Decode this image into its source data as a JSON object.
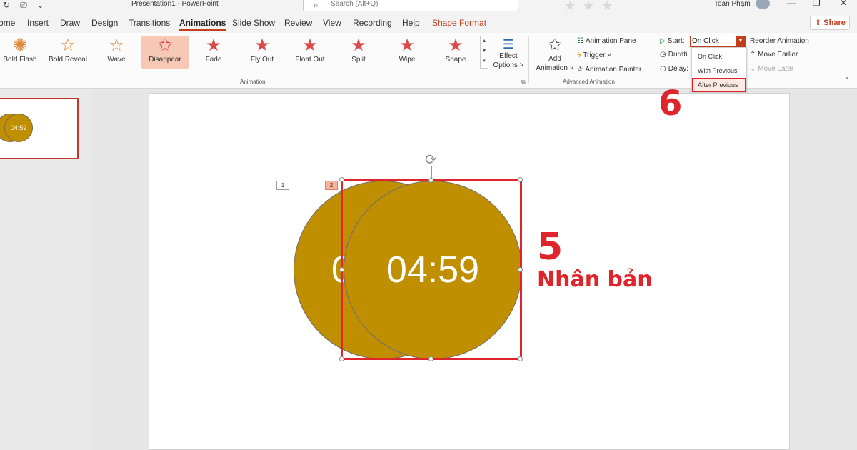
{
  "window": {
    "doc_title": "Presentation1 - PowerPoint",
    "search_placeholder": "Search (Alt+Q)",
    "user_name": "Toàn Phạm"
  },
  "tabs": [
    {
      "label": "ome"
    },
    {
      "label": "Insert"
    },
    {
      "label": "Draw"
    },
    {
      "label": "Design"
    },
    {
      "label": "Transitions"
    },
    {
      "label": "Animations",
      "active": true
    },
    {
      "label": "Slide Show"
    },
    {
      "label": "Review"
    },
    {
      "label": "View"
    },
    {
      "label": "Recording"
    },
    {
      "label": "Help"
    },
    {
      "label": "Shape Format",
      "contextual": true
    }
  ],
  "share_label": "Share",
  "ribbon": {
    "animations": [
      {
        "label": "Bold Flash",
        "icon": "star-burst-icon",
        "color": "#e08a3a"
      },
      {
        "label": "Bold Reveal",
        "icon": "star-b-icon",
        "color": "#e08a3a"
      },
      {
        "label": "Wave",
        "icon": "star-a-icon",
        "color": "#e08a3a"
      },
      {
        "label": "Disappear",
        "icon": "star-outline-icon",
        "color": "#d94a4a",
        "selected": true
      },
      {
        "label": "Fade",
        "icon": "star-icon",
        "color": "#d94a4a"
      },
      {
        "label": "Fly Out",
        "icon": "star-icon",
        "color": "#d94a4a"
      },
      {
        "label": "Float Out",
        "icon": "star-icon",
        "color": "#d94a4a"
      },
      {
        "label": "Split",
        "icon": "star-icon",
        "color": "#d94a4a"
      },
      {
        "label": "Wipe",
        "icon": "star-icon",
        "color": "#d94a4a"
      },
      {
        "label": "Shape",
        "icon": "star-icon",
        "color": "#d94a4a"
      }
    ],
    "effect_options_label_1": "Effect",
    "effect_options_label_2": "Options",
    "animation_group_label": "Animation",
    "add_animation_label_1": "Add",
    "add_animation_label_2": "Animation",
    "advanced": {
      "animation_pane": "Animation Pane",
      "trigger": "Trigger",
      "animation_painter": "Animation Painter",
      "group_label": "Advanced Animation"
    },
    "timing": {
      "start_label": "Start:",
      "start_value": "On Click",
      "duration_label": "Durati",
      "delay_label": "Delay:",
      "options": [
        "On Click",
        "With Previous",
        "After Previous"
      ],
      "highlighted_option": "After Previous"
    },
    "reorder": {
      "title": "Reorder Animation",
      "move_earlier": "Move Earlier",
      "move_later": "Move Later"
    }
  },
  "slide": {
    "thumbnail_text": "04:59",
    "back_circle_text": "0",
    "front_circle_text": "04:59",
    "circle_color": "#bf8f00",
    "anim_tags": [
      "1",
      "2"
    ]
  },
  "annotations": {
    "step5_number": "5",
    "step5_label": "Nhân bản",
    "step6_number": "6",
    "color": "#e0242b"
  }
}
